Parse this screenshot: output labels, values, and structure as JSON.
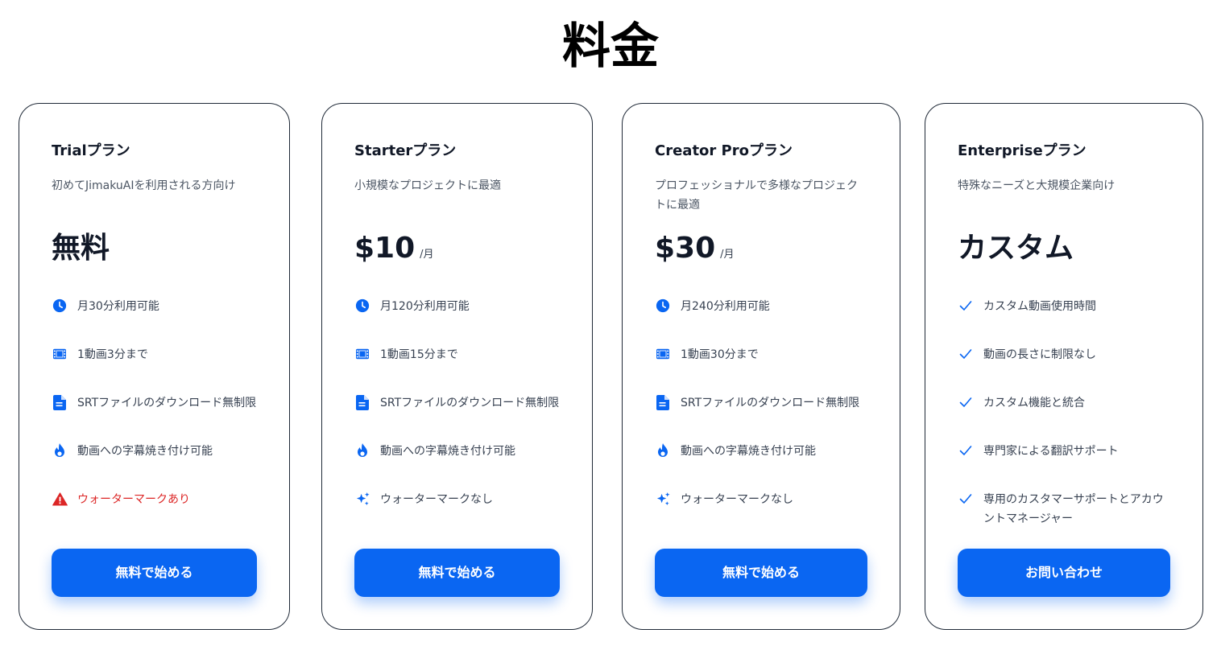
{
  "page": {
    "title": "料金"
  },
  "colors": {
    "accent": "#0a66f2",
    "warning": "#dc2626",
    "check": "#0a66f2"
  },
  "plans": [
    {
      "name": "Trialプラン",
      "description": "初めてJimakuAIを利用される方向け",
      "price": "無料",
      "price_unit": "",
      "features": [
        {
          "icon": "clock-icon",
          "text": "月30分利用可能"
        },
        {
          "icon": "film-icon",
          "text": "1動画3分まで"
        },
        {
          "icon": "document-icon",
          "text": "SRTファイルのダウンロード無制限"
        },
        {
          "icon": "fire-icon",
          "text": "動画への字幕焼き付け可能"
        },
        {
          "icon": "warning-icon",
          "text": "ウォーターマークあり"
        }
      ],
      "cta": "無料で始める"
    },
    {
      "name": "Starterプラン",
      "description": "小規模なプロジェクトに最適",
      "price": "$10",
      "price_unit": "/月",
      "features": [
        {
          "icon": "clock-icon",
          "text": "月120分利用可能"
        },
        {
          "icon": "film-icon",
          "text": "1動画15分まで"
        },
        {
          "icon": "document-icon",
          "text": "SRTファイルのダウンロード無制限"
        },
        {
          "icon": "fire-icon",
          "text": "動画への字幕焼き付け可能"
        },
        {
          "icon": "sparkles-icon",
          "text": "ウォーターマークなし"
        }
      ],
      "cta": "無料で始める"
    },
    {
      "name": "Creator Proプラン",
      "description": "プロフェッショナルで多様なプロジェクトに最適",
      "price": "$30",
      "price_unit": "/月",
      "features": [
        {
          "icon": "clock-icon",
          "text": "月240分利用可能"
        },
        {
          "icon": "film-icon",
          "text": "1動画30分まで"
        },
        {
          "icon": "document-icon",
          "text": "SRTファイルのダウンロード無制限"
        },
        {
          "icon": "fire-icon",
          "text": "動画への字幕焼き付け可能"
        },
        {
          "icon": "sparkles-icon",
          "text": "ウォーターマークなし"
        }
      ],
      "cta": "無料で始める"
    },
    {
      "name": "Enterpriseプラン",
      "description": "特殊なニーズと大規模企業向け",
      "price": "カスタム",
      "price_unit": "",
      "features": [
        {
          "icon": "check-icon",
          "text": "カスタム動画使用時間"
        },
        {
          "icon": "check-icon",
          "text": "動画の長さに制限なし"
        },
        {
          "icon": "check-icon",
          "text": "カスタム機能と統合"
        },
        {
          "icon": "check-icon",
          "text": "専門家による翻訳サポート"
        },
        {
          "icon": "check-icon",
          "text": "専用のカスタマーサポートとアカウントマネージャー"
        }
      ],
      "cta": "お問い合わせ"
    }
  ]
}
